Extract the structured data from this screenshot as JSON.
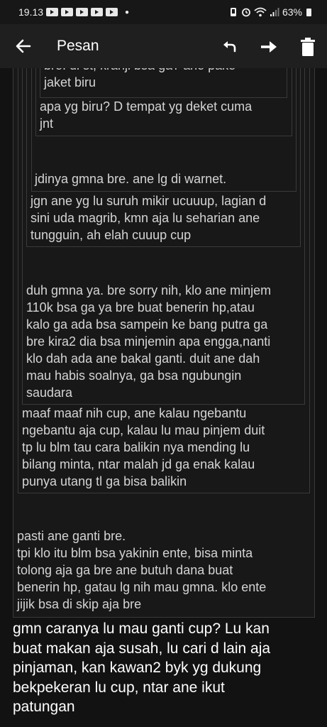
{
  "status": {
    "time": "19.13",
    "battery": "63%"
  },
  "header": {
    "title": "Pesan"
  },
  "messages": {
    "m1": "bre. di st, kranji bsa ga? ane pake\njaket biru",
    "m2": "apa yg biru? D tempat yg deket cuma\njnt",
    "m3": "jdinya gmna bre. ane lg di warnet.",
    "m4": "jgn ane yg lu suruh mikir ucuuup, lagian d\nsini uda magrib, kmn aja lu seharian ane\ntungguin, ah elah cuuup cup",
    "m5": "duh gmna ya. bre sorry nih, klo ane minjem\n110k bsa ga ya bre buat benerin hp,atau\nkalo ga ada bsa sampein ke bang putra ga\nbre kira2 dia bsa minjemin apa engga,nanti\nklo dah ada ane bakal ganti. duit ane dah\nmau habis soalnya, ga bsa ngubungin\nsaudara",
    "m6": "maaf maaf nih cup, ane kalau ngebantu\nngebantu aja cup, kalau lu mau pinjem duit\ntp lu blm tau cara balikin nya mending lu\nbilang minta, ntar malah jd ga enak kalau\npunya utang tl ga bisa balikin",
    "m7": "pasti ane ganti bre.\ntpi klo itu blm bsa yakinin ente, bisa minta\ntolong aja ga bre ane butuh dana buat\nbenerin hp, gatau lg nih mau gmna. klo ente\njijik bsa di skip aja bre",
    "m8": "gmn caranya lu mau ganti cup? Lu kan\nbuat makan aja susah, lu cari d lain aja\npinjaman, kan kawan2 byk yg dukung\nbekpekeran lu cup, ntar ane ikut\npatungan"
  }
}
